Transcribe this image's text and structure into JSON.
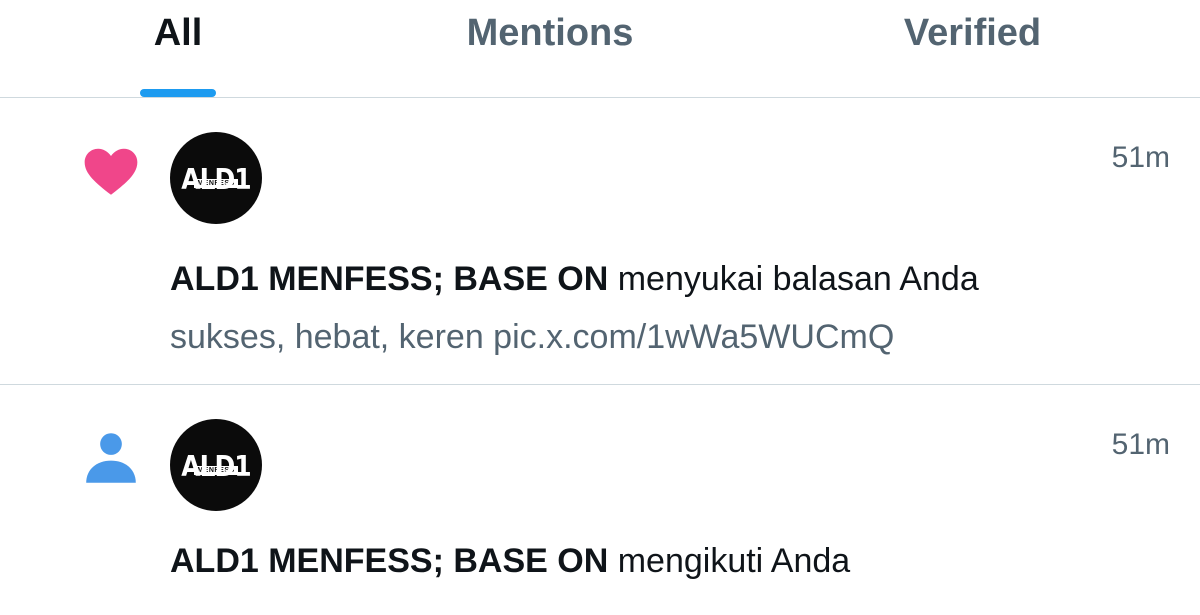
{
  "tabs": [
    {
      "label": "All",
      "active": true
    },
    {
      "label": "Mentions",
      "active": false
    },
    {
      "label": "Verified",
      "active": false
    }
  ],
  "colors": {
    "accent": "#1d9bf0",
    "like": "#f91880",
    "secondary_text": "#536471",
    "primary_text": "#0f1419"
  },
  "notifications": [
    {
      "type_icon": "heart-icon",
      "avatar": {
        "logo_text": "ALD1",
        "sub_text": "MENFESS"
      },
      "timestamp": "51m",
      "actor": "ALD1 MENFESS; BASE ON",
      "action": " menyukai balasan Anda",
      "snippet": "sukses, hebat, keren pic.x.com/1wWa5WUCmQ"
    },
    {
      "type_icon": "person-icon",
      "avatar": {
        "logo_text": "ALD1",
        "sub_text": "MENFESS"
      },
      "timestamp": "51m",
      "actor": "ALD1 MENFESS; BASE ON",
      "action": " mengikuti Anda"
    }
  ]
}
